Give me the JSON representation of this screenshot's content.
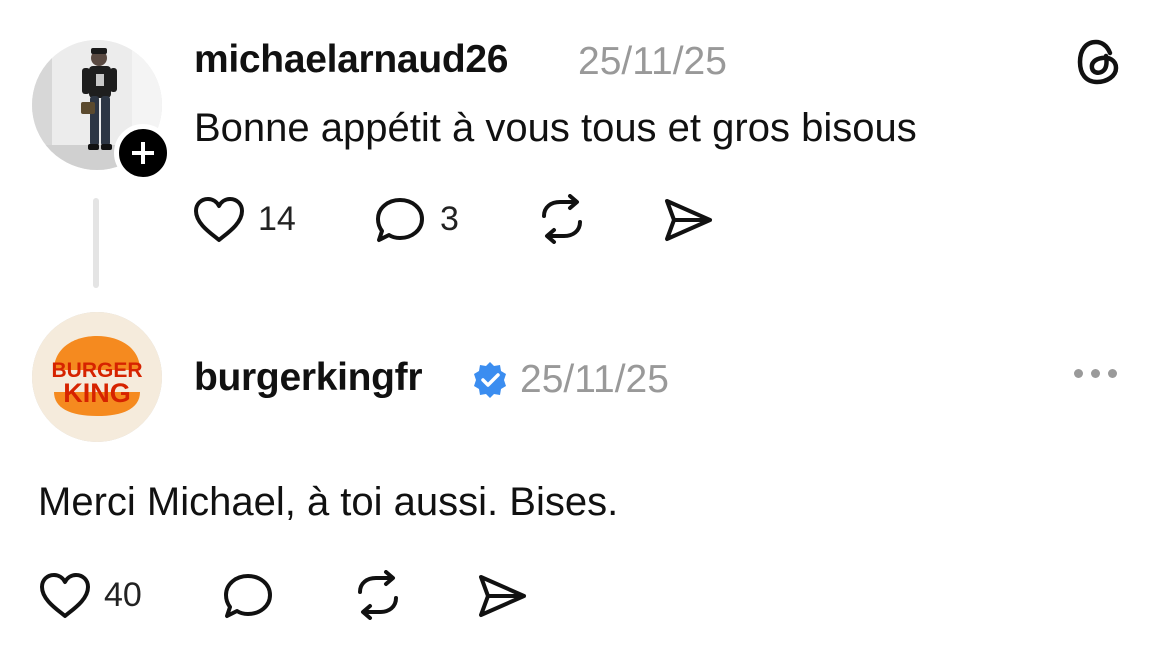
{
  "post": {
    "username": "michaelarnaud26",
    "date": "25/11/25",
    "text": "Bonne appétit à vous tous et gros bisous",
    "likes": "14",
    "replies": "3"
  },
  "reply": {
    "username": "burgerkingfr",
    "date": "25/11/25",
    "text": "Merci Michael, à toi aussi. Bises.",
    "likes": "40",
    "logo_line1": "BURGER",
    "logo_line2": "KING"
  },
  "icons": {
    "app": "threads-logo-icon",
    "verified": "verified-badge-icon",
    "like": "heart-icon",
    "reply": "comment-icon",
    "repost": "repost-icon",
    "share": "send-icon",
    "more": "more-icon",
    "follow": "plus-icon"
  },
  "colors": {
    "verified": "#3b8df0",
    "logo_bun": "#f58a1f",
    "logo_text": "#d62300",
    "muted": "#999999"
  }
}
